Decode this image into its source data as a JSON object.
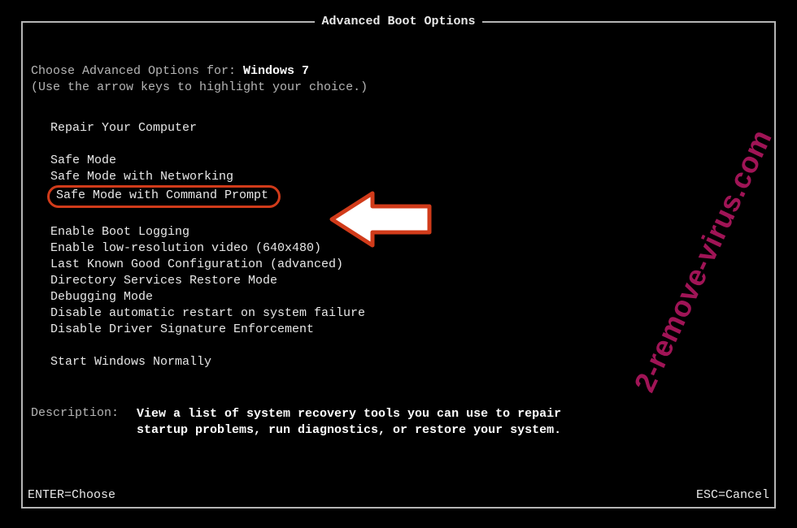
{
  "title": "Advanced Boot Options",
  "choose_prefix": "Choose Advanced Options for: ",
  "os_name": "Windows 7",
  "hint": "(Use the arrow keys to highlight your choice.)",
  "menu": {
    "group1": [
      "Repair Your Computer"
    ],
    "group2": [
      "Safe Mode",
      "Safe Mode with Networking",
      "Safe Mode with Command Prompt"
    ],
    "group3": [
      "Enable Boot Logging",
      "Enable low-resolution video (640x480)",
      "Last Known Good Configuration (advanced)",
      "Directory Services Restore Mode",
      "Debugging Mode",
      "Disable automatic restart on system failure",
      "Disable Driver Signature Enforcement"
    ],
    "group4": [
      "Start Windows Normally"
    ]
  },
  "highlighted_item": "Safe Mode with Command Prompt",
  "description": {
    "label": "Description:",
    "text": "View a list of system recovery tools you can use to repair startup problems, run diagnostics, or restore your system."
  },
  "footer": {
    "enter": "ENTER=Choose",
    "esc": "ESC=Cancel"
  },
  "watermark": "2-remove-virus.com",
  "annotation": {
    "arrow": "highlight-arrow"
  }
}
